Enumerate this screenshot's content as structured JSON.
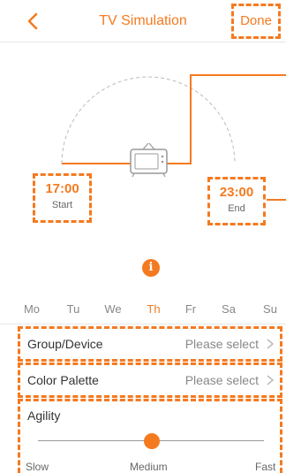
{
  "header": {
    "title": "TV Simulation",
    "done_label": "Done"
  },
  "schedule": {
    "start_time": "17:00",
    "start_label": "Start",
    "end_time": "23:00",
    "end_label": "End"
  },
  "days": [
    {
      "label": "Mo",
      "active": false
    },
    {
      "label": "Tu",
      "active": false
    },
    {
      "label": "We",
      "active": false
    },
    {
      "label": "Th",
      "active": true
    },
    {
      "label": "Fr",
      "active": false
    },
    {
      "label": "Sa",
      "active": false
    },
    {
      "label": "Su",
      "active": false
    }
  ],
  "settings": {
    "group_label": "Group/Device",
    "group_value": "Please select",
    "palette_label": "Color Palette",
    "palette_value": "Please select"
  },
  "agility": {
    "label": "Agility",
    "slow": "Slow",
    "medium": "Medium",
    "fast": "Fast",
    "level": "Medium"
  },
  "icons": {
    "back": "chevron-left-icon",
    "tv": "tv-icon",
    "info": "info-icon"
  },
  "colors": {
    "accent": "#f47a20"
  }
}
